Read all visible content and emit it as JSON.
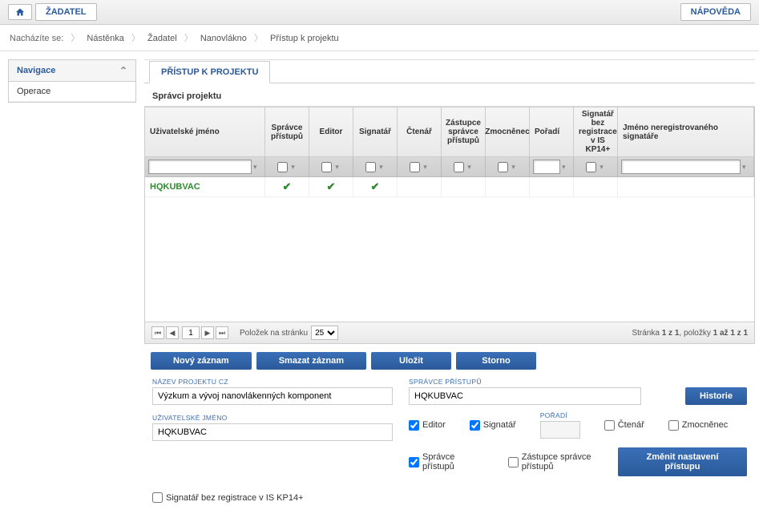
{
  "topbar": {
    "applicant": "ŽADATEL",
    "help": "NÁPOVĚDA"
  },
  "breadcrumb": {
    "label": "Nacházíte se:",
    "items": [
      "Nástěnka",
      "Žadatel",
      "Nanovlákno",
      "Přístup k projektu"
    ]
  },
  "sidebar": {
    "nav_label": "Navigace",
    "items": [
      "Operace"
    ]
  },
  "tab": "PŘÍSTUP K PROJEKTU",
  "section": "Správci projektu",
  "columns": {
    "username": "Uživatelské jméno",
    "admin": "Správce přístupů",
    "editor": "Editor",
    "signer": "Signatář",
    "reader": "Čtenář",
    "deputy": "Zástupce správce přístupů",
    "mandatary": "Zmocněnec",
    "order": "Pořadí",
    "signer_noreg": "Signatář bez registrace v IS KP14+",
    "unreg_name": "Jméno neregistrovaného signatáře"
  },
  "rows": [
    {
      "username": "HQKUBVAC",
      "admin": true,
      "editor": true,
      "signer": true,
      "reader": false,
      "deputy": false,
      "mandatary": false,
      "order": "",
      "signer_noreg": false,
      "unreg_name": ""
    }
  ],
  "pager": {
    "page": "1",
    "per_page_label": "Položek na stránku",
    "per_page": "25",
    "summary_prefix": "Stránka ",
    "summary_page": "1 z 1",
    "summary_items_prefix": ", položky ",
    "summary_items": "1 až 1 z 1"
  },
  "actions": {
    "new": "Nový záznam",
    "delete": "Smazat záznam",
    "save": "Uložit",
    "cancel": "Storno"
  },
  "form": {
    "project_name_label": "NÁZEV PROJEKTU CZ",
    "project_name": "Výzkum a vývoj nanovlákenných komponent",
    "admin_label": "SPRÁVCE PŘÍSTUPŮ",
    "admin_value": "HQKUBVAC",
    "history": "Historie",
    "username_label": "UŽIVATELSKÉ JMÉNO",
    "username_value": "HQKUBVAC",
    "order_label": "POŘADÍ",
    "order_value": "",
    "chk_editor": "Editor",
    "chk_signer": "Signatář",
    "chk_reader": "Čtenář",
    "chk_mandatary": "Zmocněnec",
    "chk_admin": "Správce přístupů",
    "chk_deputy": "Zástupce správce přístupů",
    "change_settings": "Změnit nastavení přístupu",
    "chk_signer_noreg": "Signatář bez registrace v IS KP14+"
  }
}
